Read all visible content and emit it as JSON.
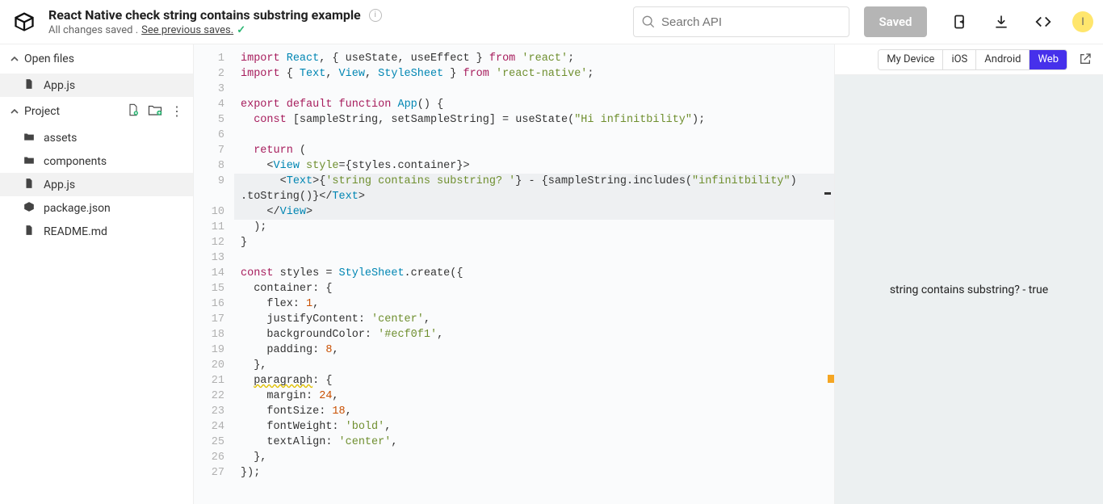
{
  "header": {
    "title": "React Native check string contains substring example",
    "subtitle_prefix": "All changes saved . ",
    "subtitle_link": "See previous saves.",
    "search_placeholder": "Search API",
    "saved_label": "Saved",
    "avatar_initial": "I"
  },
  "sidebar": {
    "open_files_label": "Open files",
    "project_label": "Project",
    "open_files": [
      {
        "name": "App.js",
        "icon": "js"
      }
    ],
    "tree": [
      {
        "name": "assets",
        "icon": "folder"
      },
      {
        "name": "components",
        "icon": "folder"
      },
      {
        "name": "App.js",
        "icon": "js",
        "active": true
      },
      {
        "name": "package.json",
        "icon": "pkg"
      },
      {
        "name": "README.md",
        "icon": "file"
      }
    ]
  },
  "editor": {
    "lines": [
      {
        "n": 1,
        "segs": [
          [
            "kw",
            "import"
          ],
          [
            "",
            " "
          ],
          [
            "var",
            "React"
          ],
          [
            "",
            ", { useState, useEffect } "
          ],
          [
            "kw",
            "from"
          ],
          [
            "",
            " "
          ],
          [
            "str",
            "'react'"
          ],
          [
            "",
            ";"
          ]
        ]
      },
      {
        "n": 2,
        "segs": [
          [
            "kw",
            "import"
          ],
          [
            "",
            " { "
          ],
          [
            "var",
            "Text"
          ],
          [
            "",
            ", "
          ],
          [
            "var",
            "View"
          ],
          [
            "",
            ", "
          ],
          [
            "var",
            "StyleSheet"
          ],
          [
            "",
            " } "
          ],
          [
            "kw",
            "from"
          ],
          [
            "",
            " "
          ],
          [
            "str",
            "'react-native'"
          ],
          [
            "",
            ";"
          ]
        ]
      },
      {
        "n": 3,
        "segs": [
          [
            "",
            ""
          ]
        ]
      },
      {
        "n": 4,
        "segs": [
          [
            "kw",
            "export"
          ],
          [
            "",
            " "
          ],
          [
            "kw",
            "default"
          ],
          [
            "",
            " "
          ],
          [
            "kw",
            "function"
          ],
          [
            "",
            " "
          ],
          [
            "fn",
            "App"
          ],
          [
            "",
            "() {"
          ]
        ]
      },
      {
        "n": 5,
        "segs": [
          [
            "",
            "  "
          ],
          [
            "kw",
            "const"
          ],
          [
            "",
            " [sampleString, setSampleString] = useState("
          ],
          [
            "str",
            "\"Hi infinitbility\""
          ],
          [
            "",
            ");"
          ]
        ]
      },
      {
        "n": 6,
        "segs": [
          [
            "",
            ""
          ]
        ]
      },
      {
        "n": 7,
        "segs": [
          [
            "",
            "  "
          ],
          [
            "kw",
            "return"
          ],
          [
            "",
            " ("
          ]
        ]
      },
      {
        "n": 8,
        "segs": [
          [
            "",
            "    <"
          ],
          [
            "tag",
            "View"
          ],
          [
            "",
            " "
          ],
          [
            "att",
            "style"
          ],
          [
            "",
            "={styles.container}>"
          ]
        ]
      },
      {
        "n": 9,
        "hl": true,
        "segs": [
          [
            "",
            "      <"
          ],
          [
            "tag",
            "Text"
          ],
          [
            "",
            ">{"
          ],
          [
            "str",
            "'string contains substring? '"
          ],
          [
            "",
            "} - {sampleString.includes("
          ],
          [
            "str",
            "\"infinitbility\""
          ],
          [
            "",
            ")"
          ]
        ]
      },
      {
        "n": null,
        "hl": true,
        "segs": [
          [
            "",
            ".toString()}</"
          ],
          [
            "tag",
            "Text"
          ],
          [
            "",
            ">"
          ]
        ]
      },
      {
        "n": 10,
        "hl": true,
        "segs": [
          [
            "",
            "    </"
          ],
          [
            "tag",
            "View"
          ],
          [
            "",
            ">"
          ]
        ]
      },
      {
        "n": 11,
        "segs": [
          [
            "",
            "  );"
          ]
        ]
      },
      {
        "n": 12,
        "segs": [
          [
            "",
            "}"
          ]
        ]
      },
      {
        "n": 13,
        "segs": [
          [
            "",
            ""
          ]
        ]
      },
      {
        "n": 14,
        "segs": [
          [
            "kw",
            "const"
          ],
          [
            "",
            " styles = "
          ],
          [
            "var",
            "StyleSheet"
          ],
          [
            "",
            ".create({"
          ]
        ]
      },
      {
        "n": 15,
        "segs": [
          [
            "",
            "  container: {"
          ]
        ]
      },
      {
        "n": 16,
        "segs": [
          [
            "",
            "    flex: "
          ],
          [
            "num",
            "1"
          ],
          [
            "",
            ","
          ]
        ]
      },
      {
        "n": 17,
        "segs": [
          [
            "",
            "    justifyContent: "
          ],
          [
            "str",
            "'center'"
          ],
          [
            "",
            ","
          ]
        ]
      },
      {
        "n": 18,
        "segs": [
          [
            "",
            "    backgroundColor: "
          ],
          [
            "str",
            "'#ecf0f1'"
          ],
          [
            "",
            ","
          ]
        ]
      },
      {
        "n": 19,
        "segs": [
          [
            "",
            "    padding: "
          ],
          [
            "num",
            "8"
          ],
          [
            "",
            ","
          ]
        ]
      },
      {
        "n": 20,
        "segs": [
          [
            "",
            "  },"
          ]
        ]
      },
      {
        "n": 21,
        "segs": [
          [
            "",
            "  "
          ],
          [
            "sq",
            "paragraph"
          ],
          [
            "",
            ": {"
          ]
        ]
      },
      {
        "n": 22,
        "segs": [
          [
            "",
            "    margin: "
          ],
          [
            "num",
            "24"
          ],
          [
            "",
            ","
          ]
        ]
      },
      {
        "n": 23,
        "segs": [
          [
            "",
            "    fontSize: "
          ],
          [
            "num",
            "18"
          ],
          [
            "",
            ","
          ]
        ]
      },
      {
        "n": 24,
        "segs": [
          [
            "",
            "    fontWeight: "
          ],
          [
            "str",
            "'bold'"
          ],
          [
            "",
            ","
          ]
        ]
      },
      {
        "n": 25,
        "segs": [
          [
            "",
            "    textAlign: "
          ],
          [
            "str",
            "'center'"
          ],
          [
            "",
            ","
          ]
        ]
      },
      {
        "n": 26,
        "segs": [
          [
            "",
            "  },"
          ]
        ]
      },
      {
        "n": 27,
        "segs": [
          [
            "",
            "});"
          ]
        ]
      }
    ]
  },
  "preview": {
    "platforms": [
      {
        "label": "My Device",
        "active": false
      },
      {
        "label": "iOS",
        "active": false
      },
      {
        "label": "Android",
        "active": false
      },
      {
        "label": "Web",
        "active": true
      }
    ],
    "output": "string contains substring?  - true"
  }
}
